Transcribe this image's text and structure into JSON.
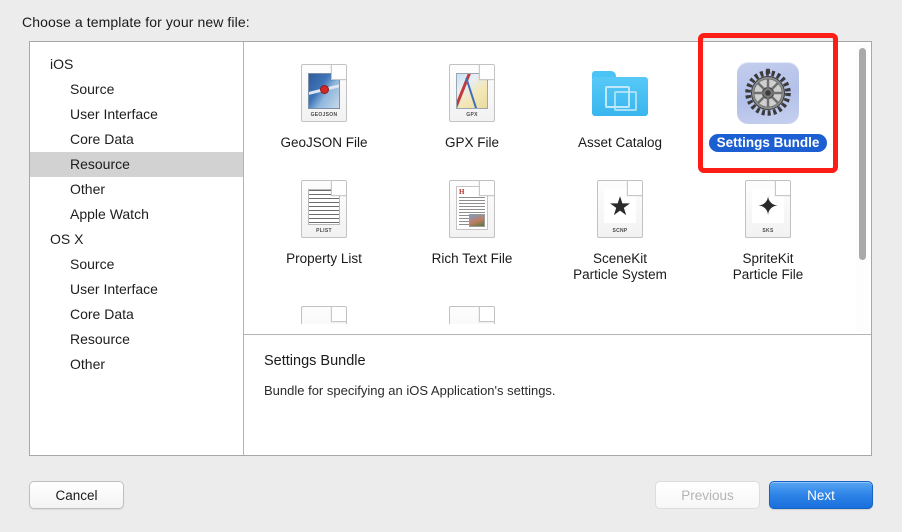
{
  "sheet": {
    "title": "Choose a template for your new file:"
  },
  "sidebar": {
    "groups": [
      {
        "label": "iOS",
        "items": [
          {
            "label": "Source",
            "selected": false
          },
          {
            "label": "User Interface",
            "selected": false
          },
          {
            "label": "Core Data",
            "selected": false
          },
          {
            "label": "Resource",
            "selected": true
          },
          {
            "label": "Other",
            "selected": false
          },
          {
            "label": "Apple Watch",
            "selected": false
          }
        ]
      },
      {
        "label": "OS X",
        "items": [
          {
            "label": "Source",
            "selected": false
          },
          {
            "label": "User Interface",
            "selected": false
          },
          {
            "label": "Core Data",
            "selected": false
          },
          {
            "label": "Resource",
            "selected": false
          },
          {
            "label": "Other",
            "selected": false
          }
        ]
      }
    ]
  },
  "templates": {
    "row1": [
      {
        "label": "GeoJSON File",
        "icon": "geojson-document-icon",
        "badge": "GEOJSON",
        "selected": false
      },
      {
        "label": "GPX File",
        "icon": "gpx-document-icon",
        "badge": "GPX",
        "selected": false
      },
      {
        "label": "Asset Catalog",
        "icon": "asset-catalog-folder-icon",
        "badge": "",
        "selected": false
      },
      {
        "label": "Settings Bundle",
        "icon": "settings-gear-icon",
        "badge": "",
        "selected": true
      }
    ],
    "row2": [
      {
        "label": "Property List",
        "icon": "plist-document-icon",
        "badge": "PLIST",
        "selected": false
      },
      {
        "label": "Rich Text File",
        "icon": "rtf-document-icon",
        "badge": "",
        "selected": false
      },
      {
        "label": "SceneKit\nParticle System",
        "icon": "scenekit-document-icon",
        "badge": "SCNP",
        "selected": false
      },
      {
        "label": "SpriteKit\nParticle File",
        "icon": "spritekit-document-icon",
        "badge": "SKS",
        "selected": false
      }
    ]
  },
  "detail": {
    "title": "Settings Bundle",
    "description": "Bundle for specifying an iOS Application's settings."
  },
  "footer": {
    "cancel": "Cancel",
    "previous": "Previous",
    "next": "Next"
  },
  "colors": {
    "selection_blue": "#1c5fd2",
    "default_button_blue": "#2f84e8",
    "annotation_red": "#fc1d17",
    "sidebar_selection_gray": "#d2d2d2",
    "window_background": "#ececec"
  }
}
